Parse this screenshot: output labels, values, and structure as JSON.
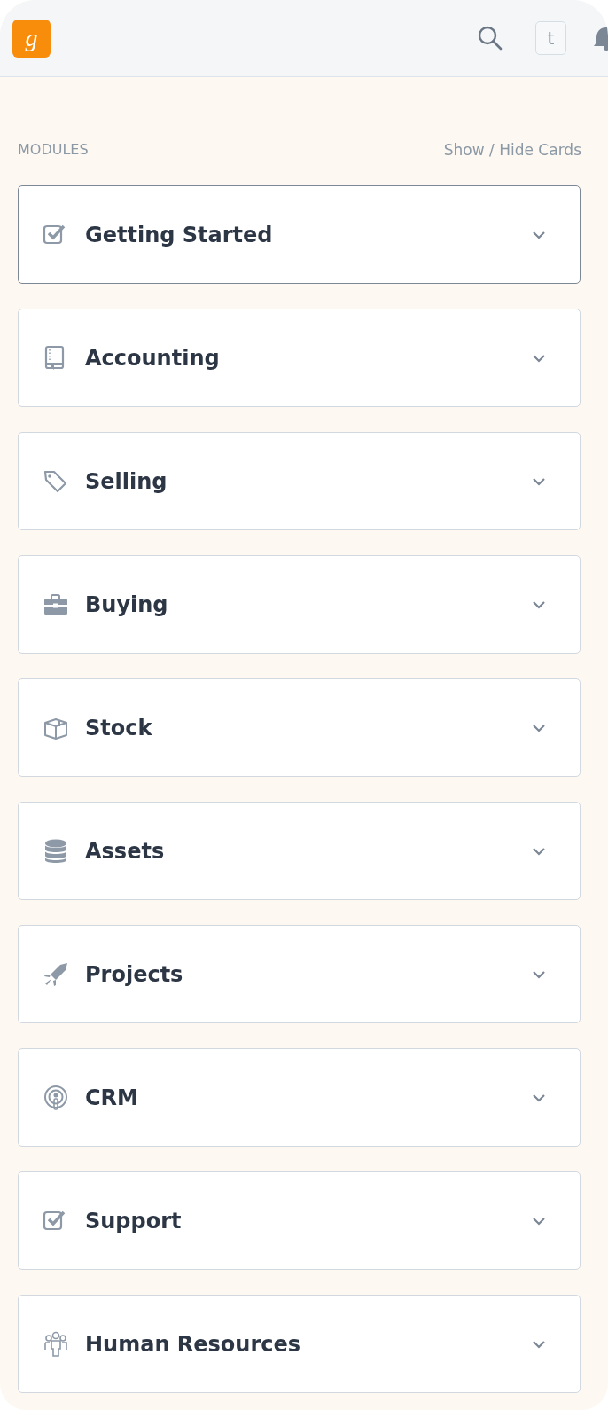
{
  "header": {
    "logo": "g",
    "avatar": "t"
  },
  "section": {
    "title": "MODULES",
    "action": "Show / Hide Cards"
  },
  "modules": [
    {
      "label": "Getting Started",
      "selected": true
    },
    {
      "label": "Accounting",
      "selected": false
    },
    {
      "label": "Selling",
      "selected": false
    },
    {
      "label": "Buying",
      "selected": false
    },
    {
      "label": "Stock",
      "selected": false
    },
    {
      "label": "Assets",
      "selected": false
    },
    {
      "label": "Projects",
      "selected": false
    },
    {
      "label": "CRM",
      "selected": false
    },
    {
      "label": "Support",
      "selected": false
    },
    {
      "label": "Human Resources",
      "selected": false
    }
  ]
}
